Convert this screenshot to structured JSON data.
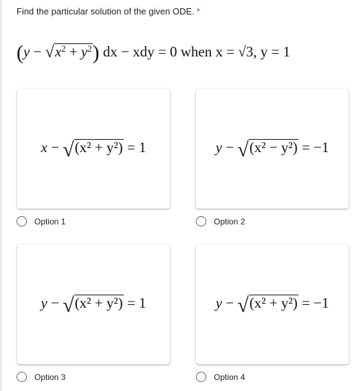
{
  "question": {
    "title": "Find the particular solution of the given ODE.",
    "required_marker": "*",
    "equation": {
      "paren_open": "(",
      "y": "y",
      "minus": " − ",
      "radicand": "x² + y²",
      "paren_close": ")",
      "rest": " dx − xdy = 0 when x = √3, y = 1"
    }
  },
  "options": [
    {
      "label": "Option 1",
      "lhs_var": "x",
      "radicand": "(x² + y²)",
      "rhs": "= 1"
    },
    {
      "label": "Option 2",
      "lhs_var": "y",
      "radicand": "(x² − y²)",
      "rhs": "= −1"
    },
    {
      "label": "Option 3",
      "lhs_var": "y",
      "radicand": "(x² + y²)",
      "rhs": "= 1"
    },
    {
      "label": "Option 4",
      "lhs_var": "y",
      "radicand": "(x² + y²)",
      "rhs": "= −1"
    }
  ],
  "colors": {
    "required": "#d93025",
    "text": "#202124",
    "radio_border": "#5f6368",
    "left_border": "#e8eaf6"
  }
}
